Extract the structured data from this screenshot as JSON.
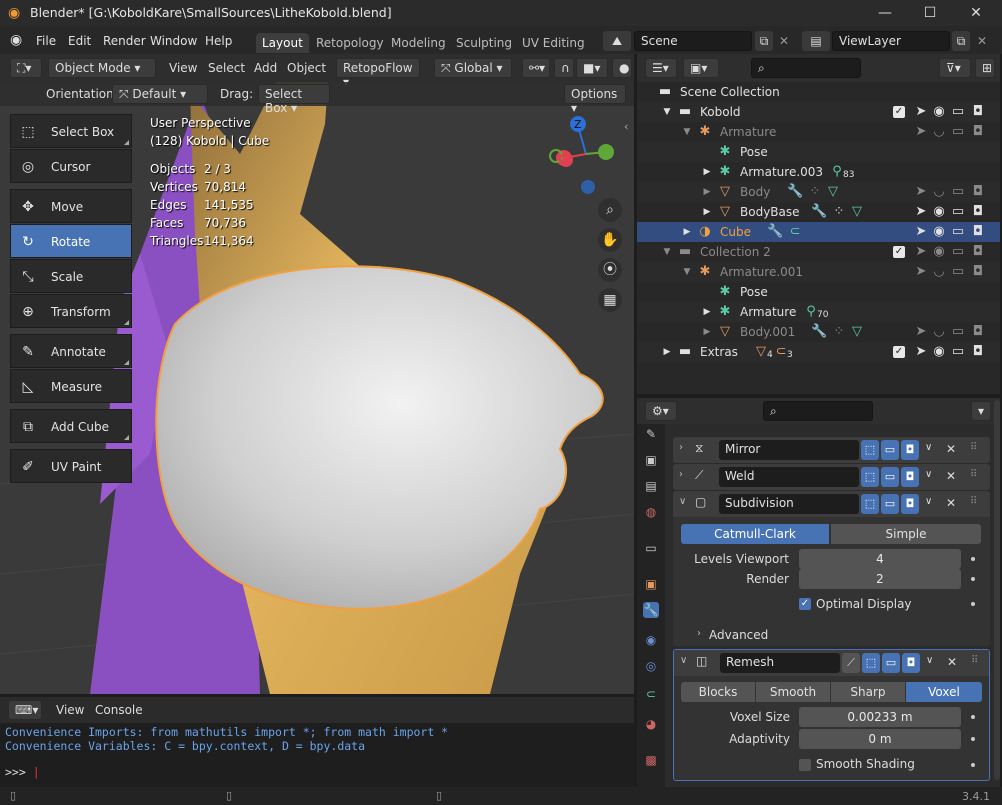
{
  "window": {
    "title": "Blender* [G:\\KoboldKare\\SmallSources\\LitheKobold.blend]",
    "minimize": "—",
    "maximize": "☐",
    "close": "✕"
  },
  "menu": {
    "items": [
      "File",
      "Edit",
      "Render",
      "Window",
      "Help"
    ]
  },
  "workspaces": {
    "tabs": [
      "Layout",
      "Retopology",
      "Modeling",
      "Sculpting",
      "UV Editing"
    ],
    "active": "Layout"
  },
  "scene": {
    "label": "Scene",
    "view_layer": "ViewLayer"
  },
  "viewport_header": {
    "mode": "Object Mode",
    "menus": [
      "View",
      "Select",
      "Add",
      "Object"
    ],
    "addon": "RetopoFlow",
    "transform": "Global",
    "orientation_label": "Orientation:",
    "orientation_value": "Default",
    "drag_label": "Drag:",
    "drag_value": "Select Box",
    "options": "Options"
  },
  "tools": [
    {
      "label": "Select Box",
      "icon": "select-box-icon",
      "glyph": "⬚"
    },
    {
      "label": "Cursor",
      "icon": "cursor-icon",
      "glyph": "◎"
    },
    {
      "label": "Move",
      "icon": "move-icon",
      "glyph": "✥"
    },
    {
      "label": "Rotate",
      "icon": "rotate-icon",
      "glyph": "↻"
    },
    {
      "label": "Scale",
      "icon": "scale-icon",
      "glyph": "⤡"
    },
    {
      "label": "Transform",
      "icon": "transform-icon",
      "glyph": "⊕"
    },
    {
      "label": "Annotate",
      "icon": "annotate-icon",
      "glyph": "✎"
    },
    {
      "label": "Measure",
      "icon": "measure-icon",
      "glyph": "📐"
    },
    {
      "label": "Add Cube",
      "icon": "add-cube-icon",
      "glyph": "⧉"
    },
    {
      "label": "UV Paint",
      "icon": "uv-paint-icon",
      "glyph": "🖌"
    }
  ],
  "viewport_info": {
    "perspective": "User Perspective",
    "object": "(128) Kobold | Cube",
    "stats": [
      {
        "label": "Objects",
        "value": "2 / 3"
      },
      {
        "label": "Vertices",
        "value": "70,814"
      },
      {
        "label": "Edges",
        "value": "141,535"
      },
      {
        "label": "Faces",
        "value": "70,736"
      },
      {
        "label": "Triangles",
        "value": "141,364"
      }
    ]
  },
  "gizmo": {
    "z": "Z"
  },
  "console": {
    "menus": [
      "View",
      "Console"
    ],
    "line1": "Convenience Imports:   from mathutils import *; from math import *",
    "line2": "Convenience Variables: C = bpy.context, D = bpy.data",
    "prompt": ">>> "
  },
  "outliner": {
    "rows": [
      {
        "label": "Scene Collection",
        "indent": 0,
        "icon": "collection-icon"
      },
      {
        "label": "Kobold",
        "indent": 1,
        "icon": "collection-icon",
        "check": true
      },
      {
        "label": "Armature",
        "indent": 2,
        "icon": "armature-icon",
        "dim": true
      },
      {
        "label": "Pose",
        "indent": 3,
        "icon": "pose-icon"
      },
      {
        "label": "Armature.003",
        "indent": 3,
        "icon": "armature-icon",
        "badge": "83"
      },
      {
        "label": "Body",
        "indent": 3,
        "icon": "mesh-icon",
        "dim": true
      },
      {
        "label": "BodyBase",
        "indent": 3,
        "icon": "mesh-icon"
      },
      {
        "label": "Cube",
        "indent": 2,
        "icon": "cube-icon",
        "selected": true
      },
      {
        "label": "Collection 2",
        "indent": 1,
        "icon": "collection-icon",
        "dim": true,
        "check": true
      },
      {
        "label": "Armature.001",
        "indent": 2,
        "icon": "armature-icon",
        "dim": true
      },
      {
        "label": "Pose",
        "indent": 3,
        "icon": "pose-icon"
      },
      {
        "label": "Armature",
        "indent": 3,
        "icon": "armature-icon",
        "badge": "70"
      },
      {
        "label": "Body.001",
        "indent": 3,
        "icon": "mesh-icon",
        "dim": true
      },
      {
        "label": "Extras",
        "indent": 1,
        "icon": "collection-icon",
        "check": true,
        "badge2": "4",
        "badge3": "3"
      }
    ]
  },
  "modifiers": {
    "mirror": "Mirror",
    "weld": "Weld",
    "subdivision": {
      "name": "Subdivision",
      "methods": [
        "Catmull-Clark",
        "Simple"
      ],
      "levels_viewport_label": "Levels Viewport",
      "levels_viewport": "4",
      "render_label": "Render",
      "render": "2",
      "optimal_display": "Optimal Display",
      "advanced": "Advanced"
    },
    "remesh": {
      "name": "Remesh",
      "modes": [
        "Blocks",
        "Smooth",
        "Sharp",
        "Voxel"
      ],
      "voxel_size_label": "Voxel Size",
      "voxel_size": "0.00233 m",
      "adaptivity_label": "Adaptivity",
      "adaptivity": "0 m",
      "smooth_shading": "Smooth Shading"
    }
  },
  "status": {
    "version": "3.4.1"
  },
  "colors": {
    "accent": "#4772b3",
    "selected_outline": "#f0a040",
    "cube_label": "#f0a040"
  }
}
